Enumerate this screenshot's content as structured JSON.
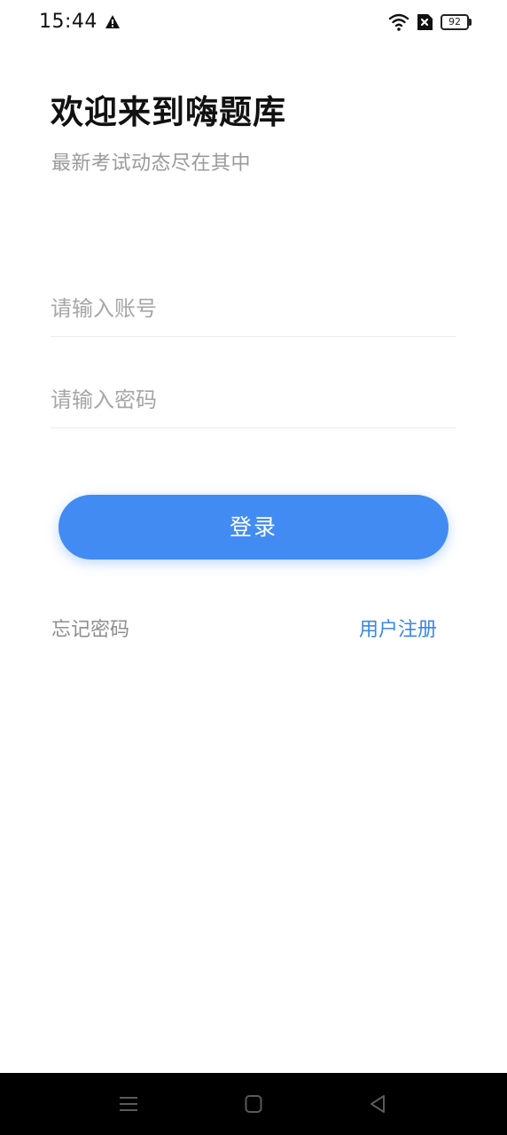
{
  "status_bar": {
    "time": "15:44",
    "battery_level": "92",
    "icons": [
      "warning-icon",
      "wifi-icon",
      "sim-card-icon",
      "battery-icon"
    ]
  },
  "header": {
    "title": "欢迎来到嗨题库",
    "subtitle": "最新考试动态尽在其中"
  },
  "form": {
    "account_placeholder": "请输入账号",
    "account_value": "",
    "password_placeholder": "请输入密码",
    "password_value": "",
    "login_label": "登录"
  },
  "links": {
    "forgot_password": "忘记密码",
    "register": "用户注册"
  },
  "nav_bar": {
    "icons": [
      "menu-icon",
      "home-icon",
      "back-icon"
    ]
  },
  "colors": {
    "primary": "#428bf2",
    "link": "#3a87e6",
    "placeholder": "#a6a6a6",
    "subtitle": "#9a9a9a",
    "nav_background": "#000000"
  }
}
